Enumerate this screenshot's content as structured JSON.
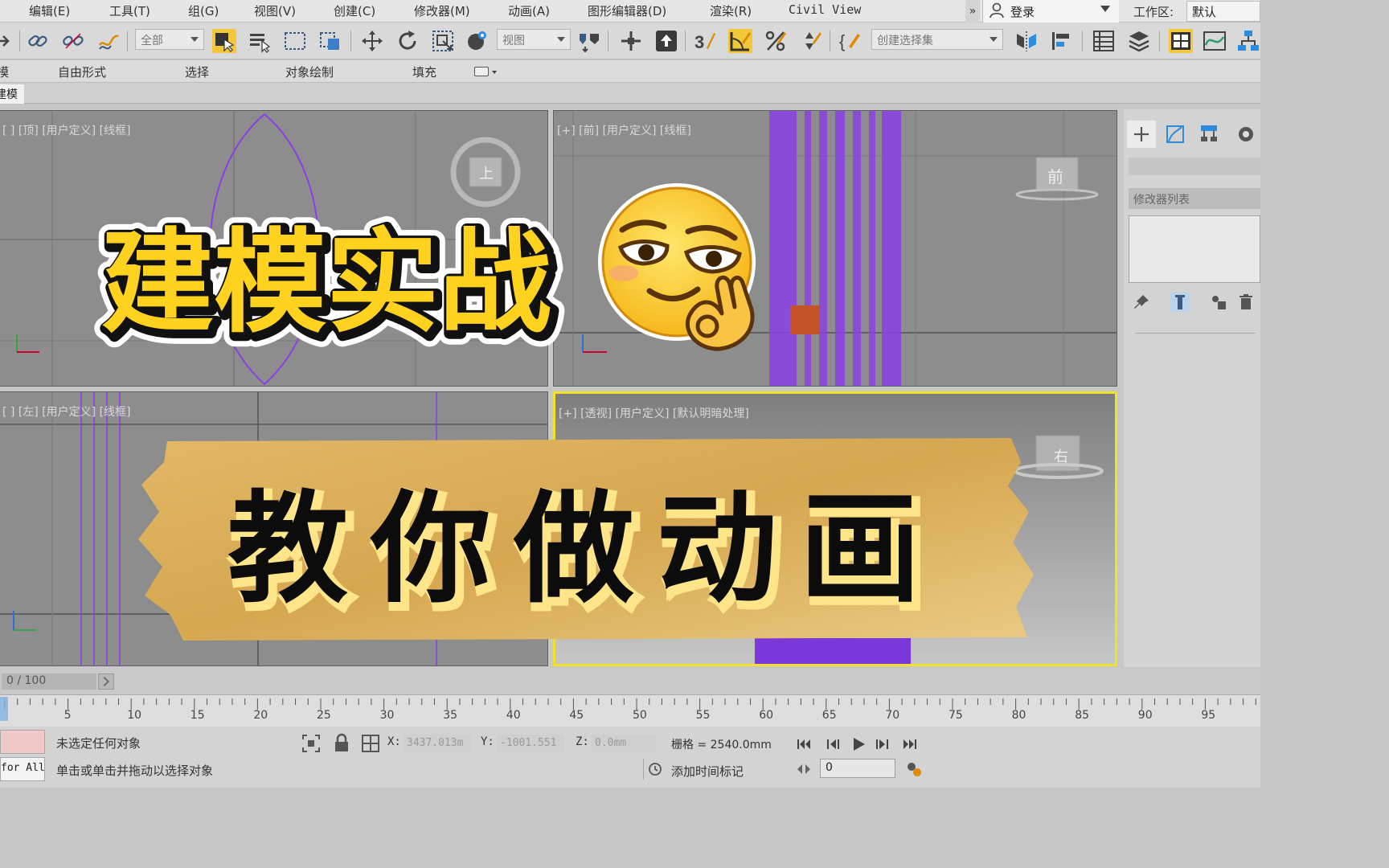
{
  "menu": {
    "items": [
      "编辑(E)",
      "工具(T)",
      "组(G)",
      "视图(V)",
      "创建(C)",
      "修改器(M)",
      "动画(A)",
      "图形编辑器(D)",
      "渲染(R)",
      "Civil View"
    ],
    "more": "»",
    "signin_label": "登录",
    "workspace_label": "工作区:",
    "workspace_value": "默认"
  },
  "toolbar": {
    "selection_filter": "全部",
    "ref_coord": "视图",
    "named_selection": "创建选择集"
  },
  "ribbon": {
    "tabs": [
      "模",
      "自由形式",
      "选择",
      "对象绘制",
      "填充"
    ],
    "sub_tab": "建模"
  },
  "viewports": {
    "top": "[ ] [顶] [用户定义] [线框]",
    "front": "[+] [前] [用户定义] [线框]",
    "left": "[ ] [左] [用户定义] [线框]",
    "perspective": "[+] [透视] [用户定义] [默认明暗处理]",
    "viewcube_top": "上",
    "viewcube_front": "前",
    "viewcube_right": "右"
  },
  "command_panel": {
    "modifier_list": "修改器列表"
  },
  "timeline": {
    "frame_display": "0 / 100",
    "tick_labels": [
      "5",
      "10",
      "15",
      "20",
      "25",
      "30",
      "35",
      "40",
      "45",
      "50",
      "55",
      "60",
      "65",
      "70",
      "75",
      "80",
      "85",
      "90",
      "95"
    ]
  },
  "status": {
    "line1": "未选定任何对象",
    "line2": "单击或单击并拖动以选择对象",
    "maxscript": "for All",
    "x_label": "X:",
    "x_value": "3437.013m",
    "y_label": "Y:",
    "y_value": "-1001.551",
    "z_label": "Z:",
    "z_value": "0.0mm",
    "grid": "栅格 = 2540.0mm",
    "add_time_tag": "添加时间标记",
    "current_frame": "0"
  },
  "overlay": {
    "title": "建模实战",
    "banner": "教你做动画"
  },
  "colors": {
    "viewport_bg": "#8d8d8d",
    "active_border": "#f2e12b",
    "object_purple": "#8a3fe6",
    "title_yellow": "#ffd21f",
    "banner_gold": "#d9a441"
  }
}
